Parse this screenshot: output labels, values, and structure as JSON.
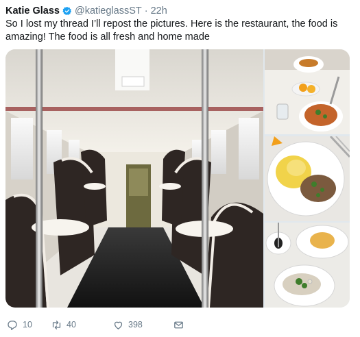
{
  "tweet": {
    "author_name": "Katie Glass",
    "handle": "@katieglassST",
    "separator": "·",
    "time": "22h",
    "text": "So I lost my thread I’ll repost the pictures. Here is the restaurant, the food is amazing! The food is all fresh  and home made",
    "verified_icon": "verified-badge-icon",
    "accent_color": "#1da1f2"
  },
  "actions": {
    "reply_count": "10",
    "retweet_count": "40",
    "like_count": "398"
  }
}
